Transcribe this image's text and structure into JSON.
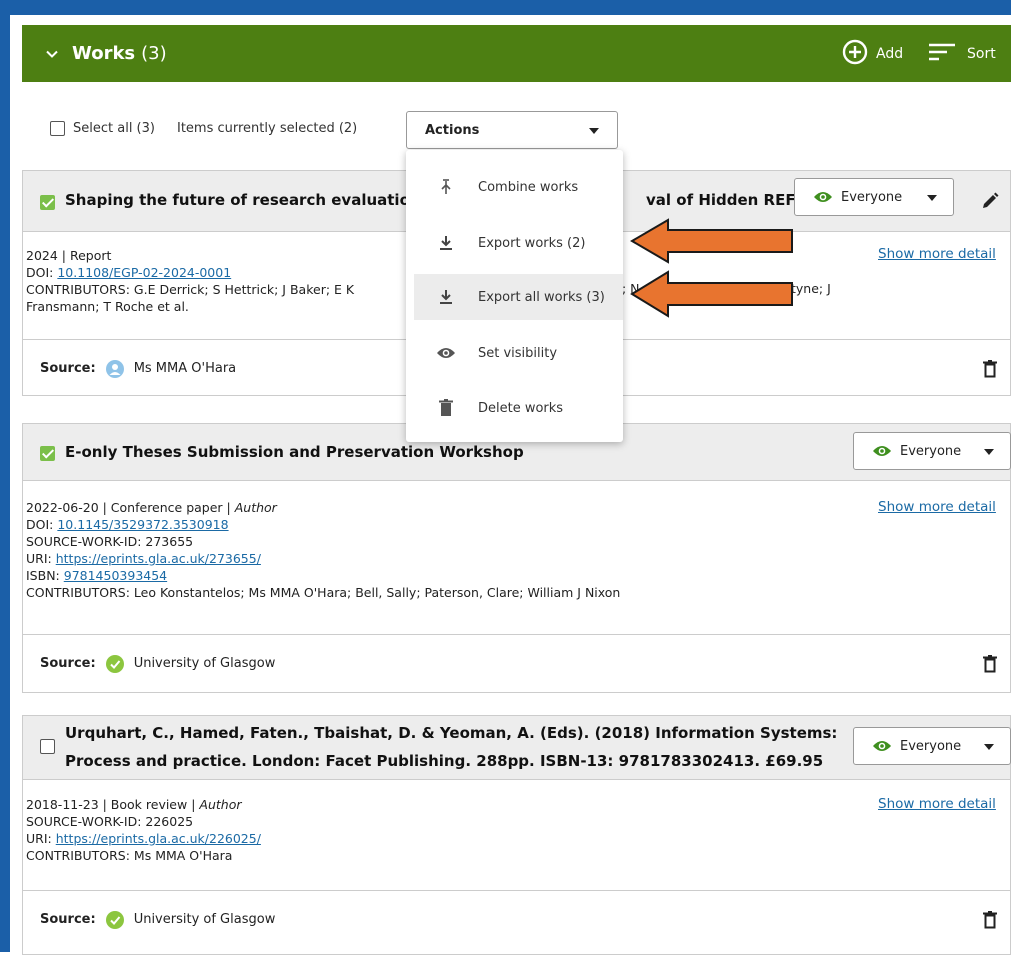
{
  "header": {
    "title": "Works",
    "count": "(3)",
    "add_label": "Add",
    "sort_label": "Sort",
    "bg_color": "#4d7f12"
  },
  "selection": {
    "select_all_label": "Select all (3)",
    "selected_info": "Items currently selected (2)"
  },
  "actions": {
    "label": "Actions",
    "items": [
      {
        "label": "Combine works",
        "icon": "combine-icon"
      },
      {
        "label": "Export works (2)",
        "icon": "download-icon"
      },
      {
        "label": "Export all works (3)",
        "icon": "download-icon"
      },
      {
        "label": "Set visibility",
        "icon": "eye-icon"
      },
      {
        "label": "Delete works",
        "icon": "trash-icon"
      }
    ]
  },
  "works": [
    {
      "title_left": "Shaping the future of research evaluatio",
      "title_right": "val of Hidden REF",
      "checked": true,
      "visibility": "Everyone",
      "meta_line1": "2024 | Report",
      "doi_label": "DOI:",
      "doi": "10.1108/EGP-02-2024-0001",
      "contributors_a": "CONTRIBUTORS: G.E Derrick; S Hettrick; J Baker; E K",
      "contributors_b": "; N",
      "contributors_c": "tyne; J",
      "contributors_d": "Fransmann; T Roche et al.",
      "show_more": "Show more detail",
      "source_label": "Source",
      "source_name": "Ms MMA O'Hara"
    },
    {
      "title": "E-only Theses Submission and Preservation Workshop",
      "checked": true,
      "visibility": "Everyone",
      "meta_line1": "2022-06-20 | Conference paper | ",
      "role": "Author",
      "doi_label": "DOI:",
      "doi": "10.1145/3529372.3530918",
      "source_work_id": "SOURCE-WORK-ID: 273655",
      "uri_label": "URI:",
      "uri": "https://eprints.gla.ac.uk/273655/",
      "isbn_label": "ISBN:",
      "isbn": "9781450393454",
      "contributors": "CONTRIBUTORS: Leo Konstantelos; Ms MMA O'Hara; Bell, Sally; Paterson, Clare; William J Nixon",
      "show_more": "Show more detail",
      "source_label": "Source",
      "source_name": "University of Glasgow"
    },
    {
      "title_line1": "Urquhart, C., Hamed, Faten., Tbaishat, D. & Yeoman, A. (Eds). (2018) Information Systems:",
      "title_line2": "Process and practice. London: Facet Publishing. 288pp. ISBN-13: 9781783302413. £69.95",
      "checked": false,
      "visibility": "Everyone",
      "meta_line1": "2018-11-23 | Book review | ",
      "role": "Author",
      "source_work_id": "SOURCE-WORK-ID: 226025",
      "uri_label": "URI:",
      "uri": "https://eprints.gla.ac.uk/226025/",
      "contributors": "CONTRIBUTORS: Ms MMA O'Hara",
      "show_more": "Show more detail",
      "source_label": "Source",
      "source_name": "University of Glasgow"
    }
  ],
  "colors": {
    "accent_green": "#4d7f12",
    "check_green": "#7bbf4a",
    "link_blue": "#1b6aa5",
    "frame_blue": "#1b5fa8",
    "arrow_orange": "#e8742f"
  }
}
